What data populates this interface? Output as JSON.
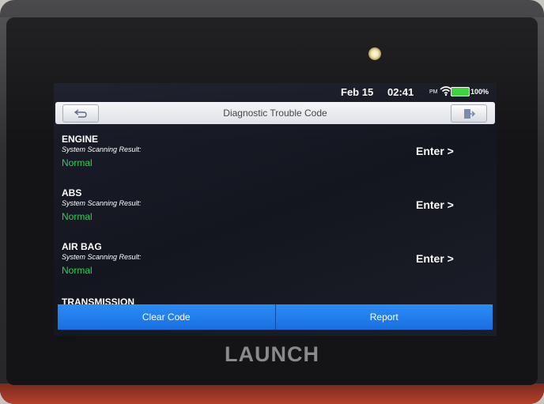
{
  "status_bar": {
    "date": "Feb 15",
    "time": "02:41",
    "ampm": "PM",
    "battery": "100%",
    "icons": [
      "wifi-icon",
      "battery-icon"
    ]
  },
  "header": {
    "title": "Diagnostic Trouble Code",
    "back_icon": "back-arrow-icon",
    "exit_icon": "exit-icon"
  },
  "systems": [
    {
      "name": "ENGINE",
      "result_label": "System Scanning Result:",
      "status": "Normal",
      "action": "Enter >"
    },
    {
      "name": "ABS",
      "result_label": "System Scanning Result:",
      "status": "Normal",
      "action": "Enter >"
    },
    {
      "name": "AIR BAG",
      "result_label": "System Scanning Result:",
      "status": "Normal",
      "action": "Enter >"
    }
  ],
  "partial_system": "TRANSMISSION",
  "footer": {
    "clear_code": "Clear Code",
    "report": "Report"
  },
  "brand": "LAUNCH",
  "colors": {
    "status_normal": "#2ed15a",
    "button_blue": "#1a6fe0",
    "battery_green": "#3bd13b"
  }
}
